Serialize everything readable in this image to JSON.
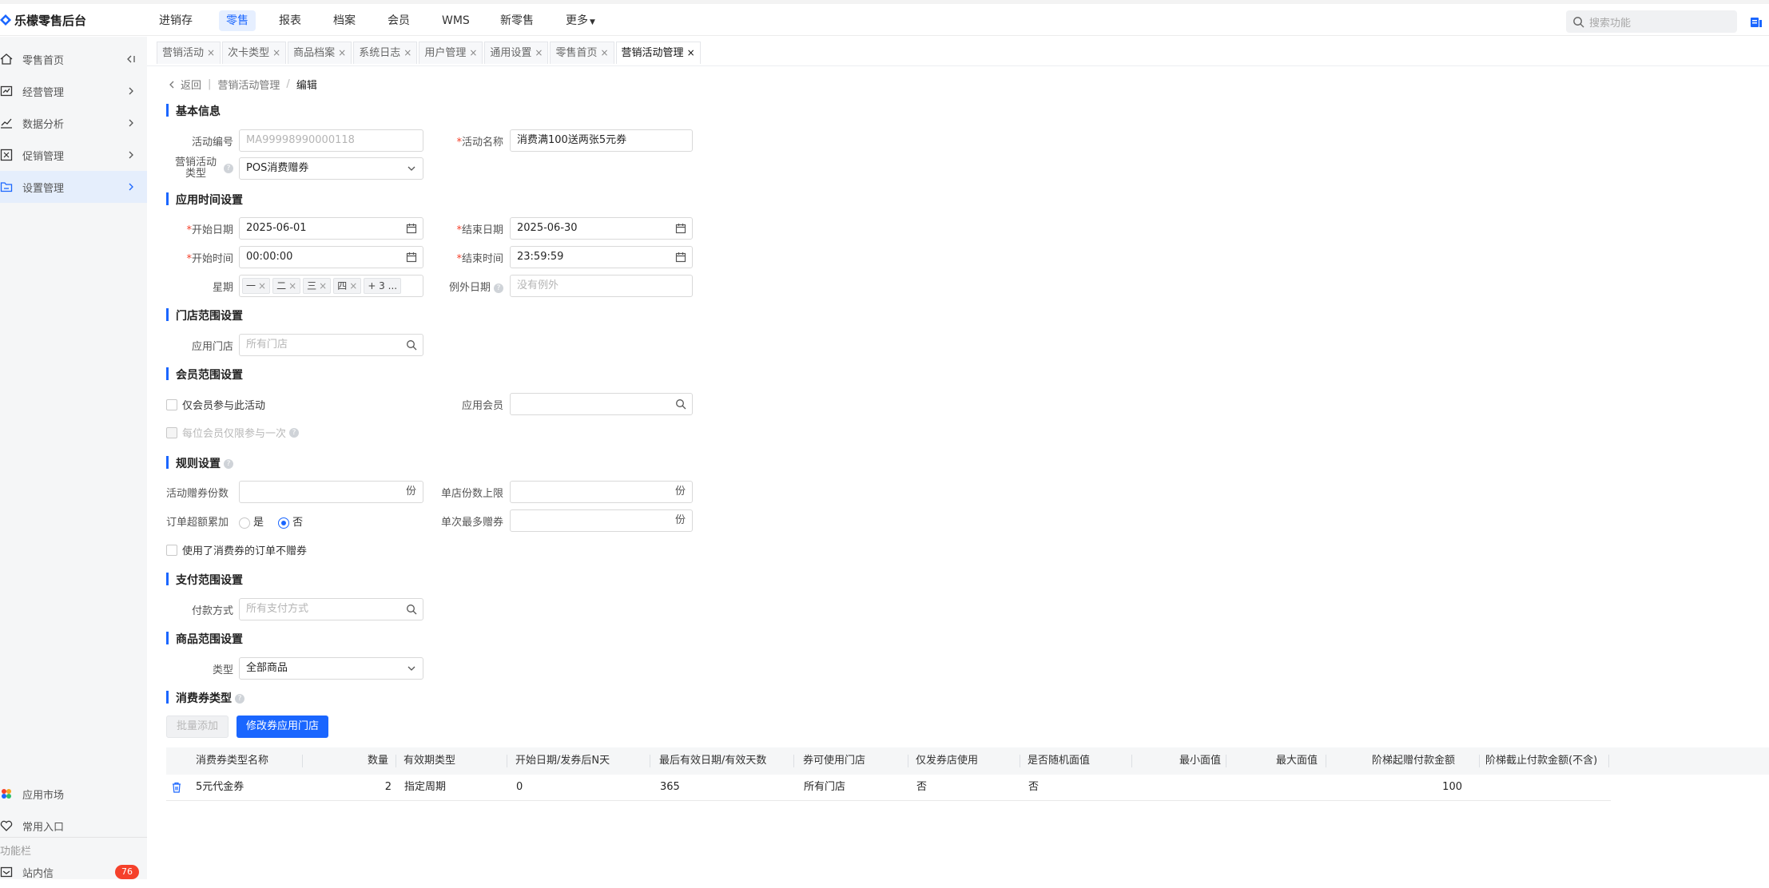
{
  "app": {
    "title": "乐檬零售后台"
  },
  "topnav": [
    "进销存",
    "零售",
    "报表",
    "档案",
    "会员",
    "WMS",
    "新零售",
    "更多"
  ],
  "search": {
    "placeholder": "搜索功能"
  },
  "sidebar": {
    "items": [
      "零售首页",
      "经营管理",
      "数据分析",
      "促销管理",
      "设置管理"
    ],
    "bottom": {
      "market": "应用市场",
      "common": "常用入口",
      "section": "功能栏",
      "message": "站内信",
      "message_count": "76"
    }
  },
  "tabs": [
    "营销活动",
    "次卡类型",
    "商品档案",
    "系统日志",
    "用户管理",
    "通用设置",
    "零售首页",
    "营销活动管理"
  ],
  "breadcrumb": {
    "back": "返回",
    "parent": "营销活动管理",
    "current": "编辑"
  },
  "sections": {
    "basic": "基本信息",
    "time": "应用时间设置",
    "store": "门店范围设置",
    "member": "会员范围设置",
    "rules": "规则设置",
    "payment": "支付范围设置",
    "goods": "商品范围设置",
    "coupon": "消费券类型"
  },
  "basic": {
    "code_label": "活动编号",
    "code_value": "MA99998990000118",
    "name_label": "活动名称",
    "name_value": "消费满100送两张5元券",
    "type_label_1": "营销活动",
    "type_label_2": "类型",
    "type_value": "POS消费赠券"
  },
  "time": {
    "start_date_label": "开始日期",
    "start_date": "2025-06-01",
    "end_date_label": "结束日期",
    "end_date": "2025-06-30",
    "start_time_label": "开始时间",
    "start_time": "00:00:00",
    "end_time_label": "结束时间",
    "end_time": "23:59:59",
    "week_label": "星期",
    "week_tags": [
      "一",
      "二",
      "三",
      "四"
    ],
    "week_more": "+ 3 ...",
    "except_label": "例外日期",
    "except_placeholder": "没有例外"
  },
  "store": {
    "label": "应用门店",
    "placeholder": "所有门店"
  },
  "member": {
    "only_member": "仅会员参与此活动",
    "apply_label": "应用会员",
    "once": "每位会员仅限参与一次"
  },
  "rules": {
    "gift_count_label": "活动赠券份数",
    "unit": "份",
    "store_limit_label": "单店份数上限",
    "accumulate_label": "订单超额累加",
    "yes": "是",
    "no": "否",
    "max_label": "单次最多赠券",
    "no_gift": "使用了消费券的订单不赠券"
  },
  "payment": {
    "label": "付款方式",
    "placeholder": "所有支付方式"
  },
  "goods": {
    "label": "类型",
    "value": "全部商品"
  },
  "coupon": {
    "batch_add": "批量添加",
    "modify_store": "修改券应用门店"
  },
  "table": {
    "headers": [
      "消费券类型名称",
      "数量",
      "有效期类型",
      "开始日期/发券后N天",
      "最后有效日期/有效天数",
      "券可使用门店",
      "仅发券店使用",
      "是否随机面值",
      "最小面值",
      "最大面值",
      "阶梯起赠付款金额",
      "阶梯截止付款金额(不含)"
    ],
    "rows": [
      {
        "name": "5元代金券",
        "qty": "2",
        "valid_type": "指定周期",
        "start": "0",
        "end": "365",
        "stores": "所有门店",
        "only_issue": "否",
        "random": "否",
        "min": "",
        "max": "",
        "from_amount": "100",
        "to_amount": ""
      }
    ]
  },
  "colors": {
    "accent": "#1a66ff",
    "badge": "#f5412b",
    "sidebar_bg": "#f5f6f7"
  }
}
